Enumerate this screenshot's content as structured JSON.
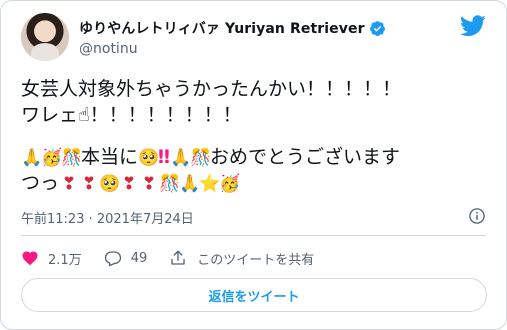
{
  "tweet": {
    "author": {
      "display_name": "ゆりやんレトリィバァ Yuriyan Retriever",
      "handle": "@notinu",
      "verified": true,
      "avatar_icon": "profile-photo"
    },
    "text_lines": [
      "女芸人対象外ちゃうかったんかい！！！！！",
      "ワレェ☝！！！！！！！！"
    ],
    "emoji_line_1": {
      "prefix_emojis": [
        "🙏",
        "🥳"
      ],
      "mid_emoji": "🎊",
      "text_a": "本当に",
      "emoji_b": "🥺",
      "marks": "‼",
      "emoji_c": [
        "🙏",
        "🎊"
      ],
      "text_b": "おめでとうございます"
    },
    "emoji_line_2": {
      "text": "つっ",
      "emojis": [
        "❣",
        "❣",
        "🥺",
        "❣",
        "❣",
        "🎊",
        "🙏",
        "⭐",
        "🥳"
      ]
    },
    "timestamp": "午前11:23 · 2021年7月24日",
    "stats": {
      "likes": "2.1万",
      "replies": "49",
      "share_label": "このツイートを共有"
    },
    "reply_button_label": "返信をツイート"
  },
  "colors": {
    "accent": "#1d9bf0",
    "like_red": "#f91880",
    "muted": "#536471",
    "border": "#cfd9de"
  },
  "icons": {
    "logo": "twitter-bird-icon",
    "verified": "verified-badge-icon",
    "info": "info-icon",
    "like": "heart-icon",
    "reply": "reply-bubble-icon",
    "share": "share-upload-icon"
  }
}
